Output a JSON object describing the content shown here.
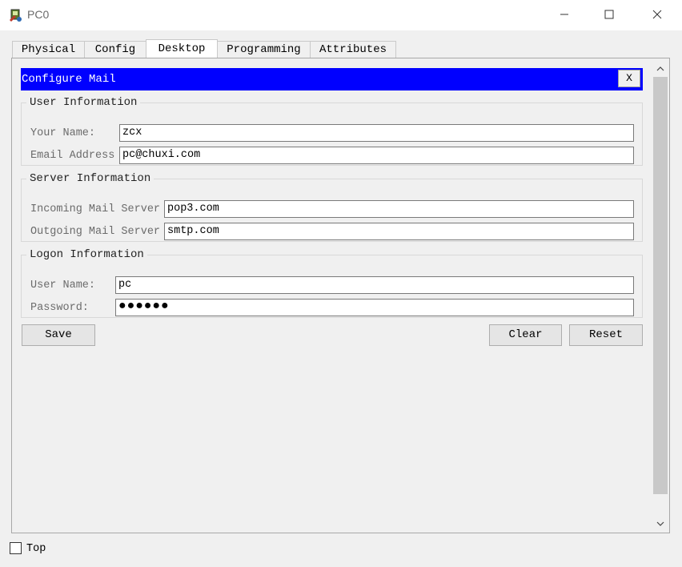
{
  "window": {
    "title": "PC0",
    "icons": [
      "app-icon",
      "minimize-icon",
      "maximize-icon",
      "close-icon"
    ]
  },
  "tabs": [
    {
      "label": "Physical"
    },
    {
      "label": "Config"
    },
    {
      "label": "Desktop",
      "active": true
    },
    {
      "label": "Programming"
    },
    {
      "label": "Attributes"
    }
  ],
  "mail": {
    "title": "Configure Mail",
    "close_label": "X",
    "header_color": "#0000ff",
    "user_info": {
      "legend": "User Information",
      "your_name_label": "Your Name:",
      "your_name_value": "zcx",
      "email_label": "Email Address",
      "email_value": "pc@chuxi.com"
    },
    "server_info": {
      "legend": "Server Information",
      "incoming_label": "Incoming Mail Server",
      "incoming_value": "pop3.com",
      "outgoing_label": "Outgoing Mail Server",
      "outgoing_value": "smtp.com"
    },
    "logon_info": {
      "legend": "Logon Information",
      "username_label": "User Name:",
      "username_value": "pc",
      "password_label": "Password:",
      "password_value": "●●●●●●"
    },
    "buttons": {
      "save": "Save",
      "clear": "Clear",
      "reset": "Reset"
    }
  },
  "footer": {
    "top_label": "Top",
    "top_checked": false
  }
}
